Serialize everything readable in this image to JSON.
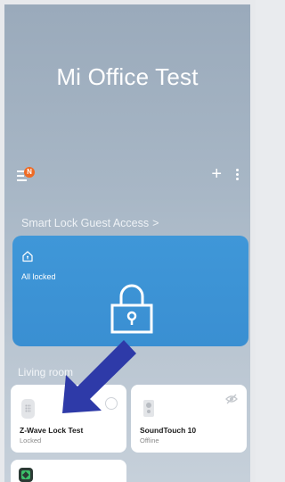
{
  "home": {
    "title": "Mi Office Test"
  },
  "toolbar": {
    "notification_badge": "N",
    "add_label": "+"
  },
  "guest_access": {
    "label": "Smart Lock Guest Access",
    "chevron": ">"
  },
  "lock_summary": {
    "status": "All locked",
    "icons": [
      "home-lock-icon",
      "padlock-icon"
    ]
  },
  "room": {
    "name": "Living room"
  },
  "devices": [
    {
      "name": "Z-Wave Lock Test",
      "status": "Locked",
      "icon": "door-lock-icon"
    },
    {
      "name": "SoundTouch 10",
      "status": "Offline",
      "icon": "speaker-icon"
    },
    {
      "name": "",
      "status": "",
      "icon": "hub-icon"
    }
  ],
  "colors": {
    "background": "#a8b7c6",
    "lock_card": "#3a8fd2",
    "badge": "#ee6a24",
    "annotation_arrow": "#2e3aa8"
  },
  "annotation": {
    "icon": "pointer-arrow",
    "target": "Z-Wave Lock Test"
  }
}
